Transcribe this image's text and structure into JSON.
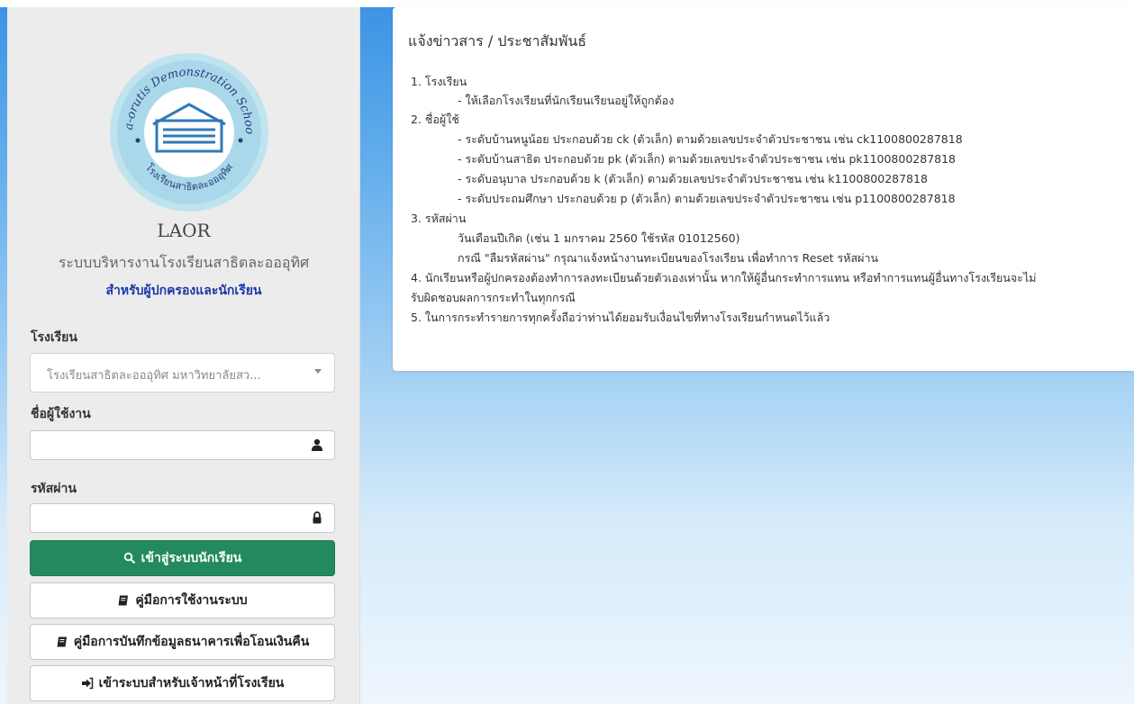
{
  "login": {
    "logo_text_top": "La-orutis Demonstration School",
    "logo_text_bottom": "โรงเรียนสาธิตละอออุทิศ",
    "app_title": "LAOR",
    "app_subtitle": "ระบบบริหารงานโรงเรียนสาธิตละอออุทิศ",
    "app_audience": "สำหรับผู้ปกครองและนักเรียน",
    "school_label": "โรงเรียน",
    "school_selected": "โรงเรียนสาธิตละอออุทิศ มหาวิทยาลัยสว...",
    "username_label": "ชื่อผู้ใช้งาน",
    "username_value": "",
    "password_label": "รหัสผ่าน",
    "password_value": "",
    "login_button": "เข้าสู่ระบบนักเรียน",
    "manual_button": "คู่มือการใช้งานระบบ",
    "bank_manual_button": "คู่มือการบันทึกข้อมูลธนาคารเพื่อโอนเงินคืน",
    "staff_login_button": "เข้าระบบสำหรับเจ้าหน้าที่โรงเรียน"
  },
  "news": {
    "title": "แจ้งข่าวสาร / ประชาสัมพันธ์",
    "lines": [
      "1. โรงเรียน",
      "- ให้เลือกโรงเรียนที่นักเรียนเรียนอยู่ให้ถูกต้อง",
      "2. ชื่อผู้ใช้",
      "- ระดับบ้านหนูน้อย ประกอบด้วย ck (ตัวเล็ก) ตามด้วยเลขประจำตัวประชาชน เช่น ck1100800287818",
      "- ระดับบ้านสาธิต ประกอบด้วย pk (ตัวเล็ก) ตามด้วยเลขประจำตัวประชาชน เช่น pk1100800287818",
      "- ระดับอนุบาล ประกอบด้วย k (ตัวเล็ก) ตามด้วยเลขประจำตัวประชาชน เช่น k1100800287818",
      "- ระดับประถมศึกษา ประกอบด้วย p (ตัวเล็ก) ตามด้วยเลขประจำตัวประชาชน เช่น p1100800287818",
      "3. รหัสผ่าน",
      "วันเดือนปีเกิด (เช่น 1 มกราคม 2560 ใช้รหัส 01012560)",
      "กรณี \"ลืมรหัสผ่าน\" กรุณาแจ้งหน้างานทะเบียนของโรงเรียน เพื่อทำการ Reset รหัสผ่าน",
      "4. นักเรียนหรือผู้ปกครองต้องทำการลงทะเบียนด้วยตัวเองเท่านั้น หากให้ผู้อื่นกระทำการแทน หรือทำการแทนผู้อื่นทางโรงเรียนจะไม่",
      "รับผิดชอบผลการกระทำในทุกกรณี",
      "5. ในการกระทำรายการทุกครั้งถือว่าท่านได้ยอมรับเงื่อนไขที่ทางโรงเรียนกำหนดไว้แล้ว"
    ]
  }
}
